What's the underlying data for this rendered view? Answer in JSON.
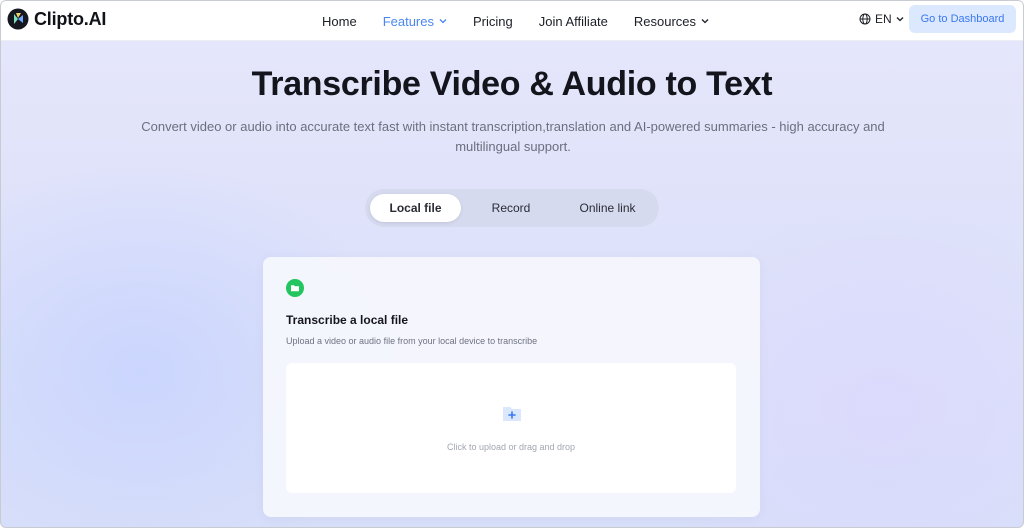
{
  "brand": {
    "name": "Clipto.AI",
    "accent": "#4a86f0"
  },
  "nav": {
    "items": [
      {
        "label": "Home",
        "active": false,
        "has_dropdown": false
      },
      {
        "label": "Features",
        "active": true,
        "has_dropdown": true
      },
      {
        "label": "Pricing",
        "active": false,
        "has_dropdown": false
      },
      {
        "label": "Join Affiliate",
        "active": false,
        "has_dropdown": false
      },
      {
        "label": "Resources",
        "active": false,
        "has_dropdown": true
      }
    ],
    "language": {
      "icon": "globe-icon",
      "label": "EN"
    },
    "dashboard_button": "Go to Dashboard"
  },
  "hero": {
    "title": "Transcribe Video & Audio to Text",
    "subtitle": "Convert video or audio into accurate text fast with instant transcription,translation and AI-powered summaries - high accuracy and multilingual support."
  },
  "tabs": [
    {
      "label": "Local file",
      "active": true
    },
    {
      "label": "Record",
      "active": false
    },
    {
      "label": "Online link",
      "active": false
    }
  ],
  "card": {
    "icon": "folder-icon",
    "title": "Transcribe a local file",
    "description": "Upload a video or audio file from your local device to transcribe",
    "dropzone": {
      "icon": "folder-plus-icon",
      "text": "Click to upload or drag and drop"
    }
  }
}
